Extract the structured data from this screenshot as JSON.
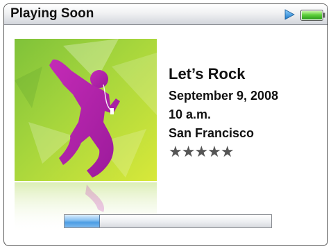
{
  "header": {
    "title": "Playing Soon",
    "icons": [
      "play-icon",
      "battery-icon"
    ],
    "battery_level": 1.0
  },
  "event": {
    "title": "Let’s Rock",
    "date": "September 9, 2008",
    "time": "10 a.m.",
    "location": "San Francisco",
    "rating_stars": "★★★★★",
    "rating_value": 5
  },
  "progress": {
    "fraction": 0.17
  },
  "colors": {
    "art_green": "#8cc83c",
    "silhouette_magenta": "#b01ea8",
    "progress_blue": "#4c9ee4",
    "play_blue": "#2a8fd8",
    "battery_green": "#3fbf2c"
  }
}
